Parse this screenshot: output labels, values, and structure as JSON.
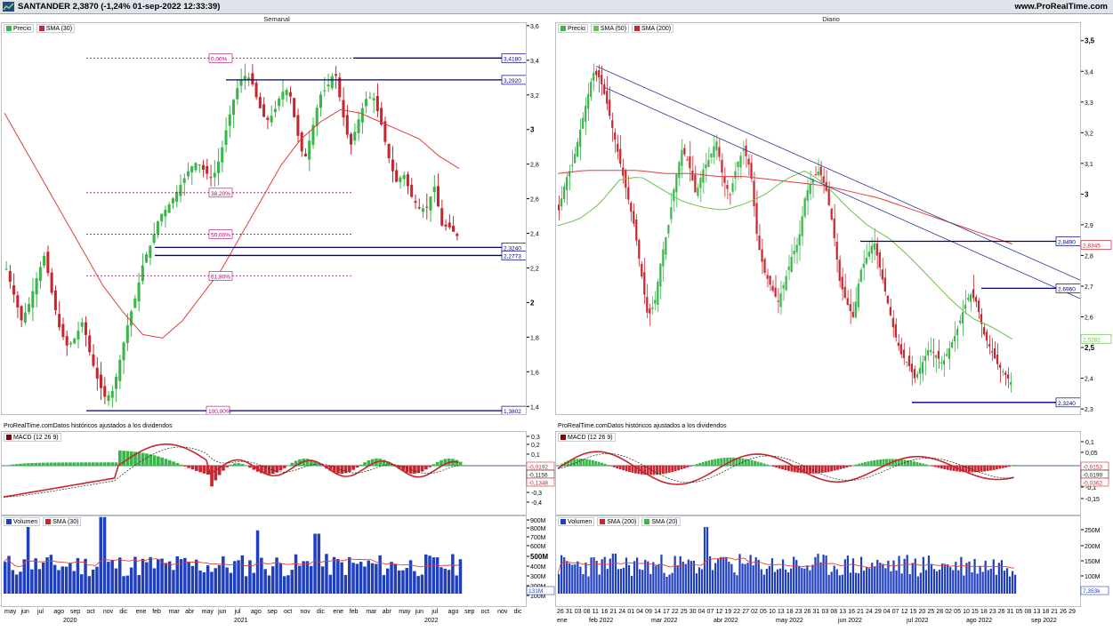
{
  "header": {
    "ticker": "SANTANDER 2,3870 (-1,24% 01-sep-2022 12:33:39)",
    "site": "www.ProRealTime.com",
    "colors": {
      "up": "#39b54a",
      "down": "#c8262e",
      "sma_red": "#e0403a",
      "sma_green": "#6cc24a",
      "fib": "#b0006e",
      "level": "#000080",
      "volume": "#1f3fbf"
    }
  },
  "panels": {
    "left_title": "Semanal",
    "right_title": "Diario",
    "caption": "ProRealTime.comDatos históricos ajustados a los dividendos"
  },
  "legends": {
    "left_price": [
      "Precio",
      "SMA (30)"
    ],
    "right_price": [
      "Precio",
      "SMA (50)",
      "SMA (200)"
    ],
    "macd_left": "MACD (12 26 9)",
    "macd_right": "MACD (12 26 9)",
    "vol_left": [
      "Volumen",
      "SMA (30)"
    ],
    "vol_right": [
      "Volumen",
      "SMA (200)",
      "SMA (20)"
    ]
  },
  "levels_left": {
    "fib": [
      {
        "label": "0,00%",
        "price": 3.418
      },
      {
        "label": "38,20%",
        "price": 2.64
      },
      {
        "label": "50,00%",
        "price": 2.4
      },
      {
        "label": "61,80%",
        "price": 2.16
      },
      {
        "label": "100,00%",
        "price": 1.3802
      }
    ],
    "boxes": [
      "3,4180",
      "3,2920",
      "2,3240",
      "2,2773",
      "1,3802"
    ]
  },
  "levels_right": {
    "boxes": [
      "2,8490",
      "2,8345",
      "2,6960",
      "2,5282",
      "2,3240"
    ]
  },
  "macd_left_vals": [
    "-0,0192",
    "-0,1156",
    "-0,1348"
  ],
  "macd_right_vals": [
    "-0,0153",
    "-0,0199",
    "-0,0362"
  ],
  "vol_left_val": "131M",
  "vol_right_val": "7,353k",
  "chart_data": [
    {
      "type": "candlestick",
      "title": "Semanal",
      "series": [
        {
          "name": "Precio",
          "values": [
            2.2,
            2.05,
            1.9,
            2.0,
            2.15,
            2.28,
            2.05,
            1.85,
            1.75,
            1.8,
            1.9,
            1.7,
            1.55,
            1.45,
            1.5,
            1.7,
            1.9,
            2.05,
            2.25,
            2.35,
            2.5,
            2.55,
            2.62,
            2.7,
            2.78,
            2.82,
            2.76,
            2.72,
            2.85,
            3.05,
            3.22,
            3.32,
            3.3,
            3.15,
            3.05,
            3.1,
            3.22,
            3.24,
            3.0,
            2.82,
            3.0,
            3.2,
            3.25,
            3.35,
            3.1,
            2.9,
            3.05,
            3.18,
            3.2,
            3.05,
            2.85,
            2.7,
            2.75,
            2.62,
            2.55,
            2.55,
            2.68,
            2.45,
            2.44,
            2.39
          ]
        },
        {
          "name": "SMA (30)",
          "values": [
            3.1,
            2.9,
            2.7,
            2.5,
            2.3,
            2.1,
            1.95,
            1.82,
            1.8,
            1.9,
            2.05,
            2.2,
            2.4,
            2.6,
            2.8,
            2.95,
            3.05,
            3.12,
            3.1,
            3.05,
            3.0,
            2.95,
            2.85,
            2.78
          ]
        }
      ],
      "ylim": [
        1.35,
        3.62
      ],
      "yticks": [
        "3,6",
        "3,4",
        "3,2",
        "3",
        "2,8",
        "2,6",
        "2,4",
        "2,2",
        "2",
        "1,8",
        "1,6",
        "1,4"
      ],
      "xticks": [
        "may",
        "jun",
        "jul",
        "ago",
        "sep",
        "oct",
        "nov",
        "dic",
        "ene",
        "feb",
        "mar",
        "abr",
        "may",
        "jun",
        "jul",
        "ago",
        "sep",
        "oct",
        "nov",
        "dic",
        "ene",
        "feb",
        "mar",
        "abr",
        "may",
        "jun",
        "jul",
        "ago",
        "sep",
        "oct",
        "nov",
        "dic"
      ],
      "xticks_years": [
        "2020",
        "2021",
        "2022"
      ]
    },
    {
      "type": "candlestick",
      "title": "Diario",
      "series": [
        {
          "name": "Precio",
          "values": [
            2.95,
            3.05,
            3.1,
            3.2,
            3.3,
            3.4,
            3.38,
            3.3,
            3.2,
            3.1,
            3.0,
            2.9,
            2.75,
            2.6,
            2.65,
            2.8,
            2.9,
            3.05,
            3.15,
            3.1,
            3.0,
            3.08,
            3.12,
            3.18,
            3.05,
            3.0,
            3.1,
            3.15,
            3.08,
            2.85,
            2.75,
            2.7,
            2.65,
            2.72,
            2.8,
            2.85,
            3.0,
            3.05,
            3.08,
            3.02,
            2.9,
            2.72,
            2.65,
            2.6,
            2.75,
            2.8,
            2.85,
            2.75,
            2.65,
            2.55,
            2.48,
            2.45,
            2.4,
            2.45,
            2.5,
            2.48,
            2.45,
            2.5,
            2.55,
            2.62,
            2.68,
            2.65,
            2.55,
            2.5,
            2.45,
            2.42,
            2.39
          ]
        },
        {
          "name": "SMA (50)",
          "values": [
            2.9,
            2.92,
            2.97,
            3.05,
            3.06,
            3.02,
            2.98,
            2.96,
            2.95,
            2.97,
            3.0,
            3.05,
            3.08,
            3.03,
            2.96,
            2.9,
            2.86,
            2.8,
            2.73,
            2.66,
            2.6,
            2.57,
            2.53
          ]
        },
        {
          "name": "SMA (200)",
          "values": [
            3.07,
            3.08,
            3.08,
            3.08,
            3.07,
            3.07,
            3.06,
            3.06,
            3.05,
            3.04,
            3.03,
            3.01,
            2.99,
            2.96,
            2.93,
            2.9,
            2.87,
            2.84
          ]
        }
      ],
      "ylim": [
        2.28,
        3.56
      ],
      "yticks": [
        "3,5",
        "3,4",
        "3,3",
        "3,2",
        "3,1",
        "3",
        "2,9",
        "2,8",
        "2,7",
        "2,6",
        "2,5",
        "2,4",
        "2,3"
      ],
      "xticks": [
        "26",
        "31",
        "03",
        "08",
        "11",
        "16",
        "21",
        "24",
        "01",
        "04",
        "09",
        "14",
        "17",
        "22",
        "25",
        "30",
        "04",
        "07",
        "12",
        "19",
        "22",
        "27",
        "02",
        "05",
        "10",
        "13",
        "18",
        "23",
        "26",
        "31",
        "03",
        "08",
        "13",
        "16",
        "21",
        "24",
        "29",
        "04",
        "07",
        "12",
        "15",
        "20",
        "25",
        "28",
        "02",
        "05",
        "10",
        "15",
        "18",
        "23",
        "26",
        "31",
        "05",
        "08",
        "13",
        "18",
        "21",
        "26",
        "29"
      ],
      "xticks_months": [
        "ene",
        "feb 2022",
        "mar 2022",
        "abr 2022",
        "may 2022",
        "jun 2022",
        "jul 2022",
        "ago 2022",
        "sep 2022"
      ]
    }
  ]
}
